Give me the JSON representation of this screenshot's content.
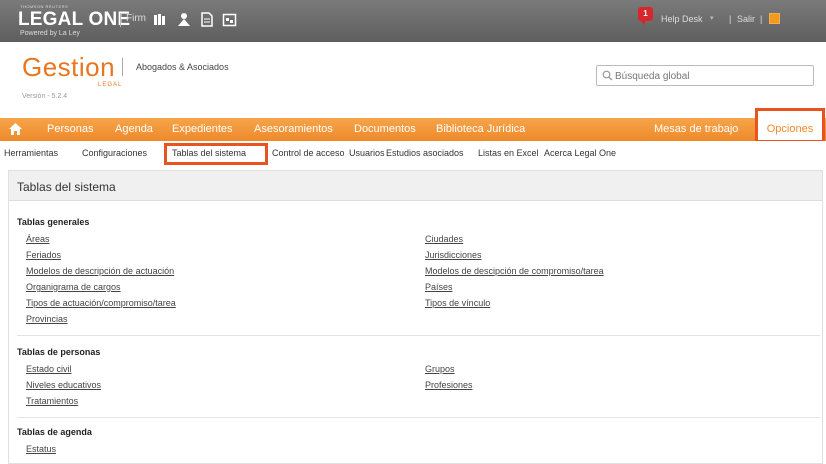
{
  "topbar": {
    "brand": "THOMSON REUTERS",
    "title": "LEGAL ONE",
    "firm": "Firm",
    "powered": "Powered by La Ley",
    "notification_count": "1",
    "help_desk": "Help Desk",
    "separator": "|",
    "logout": "Salir"
  },
  "logo": {
    "name": "Gestion",
    "legal": "LEGAL",
    "version": "Versión - 5.2.4",
    "company": "Abogados & Asociados"
  },
  "search": {
    "placeholder": "Búsqueda global"
  },
  "nav": {
    "items": [
      "Personas",
      "Agenda",
      "Expedientes",
      "Asesoramientos",
      "Documentos",
      "Biblioteca Jurídica"
    ],
    "workspaces": "Mesas de trabajo",
    "options": "Opciones"
  },
  "subnav": {
    "items": [
      "Herramientas",
      "Configuraciones",
      "Tablas del sistema",
      "Control de acceso",
      "Usuarios",
      "Estudios asociados",
      "Listas en Excel",
      "Acerca Legal One"
    ]
  },
  "main": {
    "title": "Tablas del sistema",
    "sections": [
      {
        "title": "Tablas generales",
        "left": [
          "Áreas",
          "Feriados",
          "Modelos de descripción de actuación",
          "Organigrama de cargos",
          "Tipos de actuación/compromiso/tarea",
          "Provincias"
        ],
        "right": [
          "Ciudades",
          "Jurisdicciones",
          "Modelos de descipción de compromiso/tarea",
          "Países",
          "Tipos de vínculo"
        ]
      },
      {
        "title": "Tablas de personas",
        "left": [
          "Estado civil",
          "Niveles educativos",
          "Tratamientos"
        ],
        "right": [
          "Grupos",
          "Profesiones"
        ]
      },
      {
        "title": "Tablas de agenda",
        "left": [
          "Estatus"
        ],
        "right": []
      }
    ]
  },
  "colors": {
    "accent": "#f39a3c",
    "highlight": "#e8531f",
    "topbar": "#6b6b6b"
  }
}
